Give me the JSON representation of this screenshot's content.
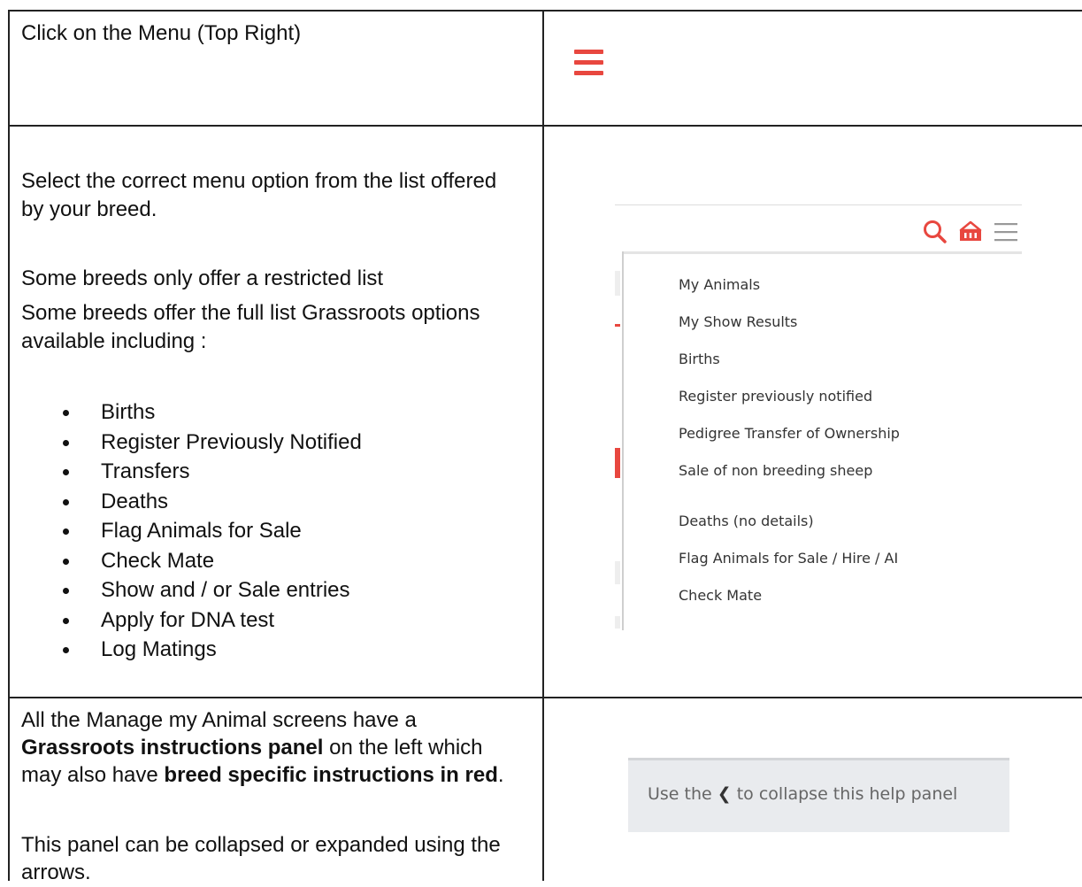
{
  "row1": {
    "instruction": "Click on the Menu (Top Right)",
    "menu_icon": "hamburger-menu-icon",
    "accent_color": "#e8473f"
  },
  "row2": {
    "instruction_line1": "Select the correct menu option from the list offered",
    "instruction_line2": "by your breed.",
    "restricted": "Some breeds only offer a restricted list",
    "full_line1": "Some breeds offer the full list Grassroots options",
    "full_line2": "available including :",
    "bullets": [
      "Births",
      "Register Previously Notified",
      "Transfers",
      "Deaths",
      "Flag Animals for Sale",
      "Check Mate",
      "Show and / or Sale entries",
      "Apply for DNA test",
      "Log Matings"
    ],
    "menu_screenshot": {
      "icons": [
        "search-icon",
        "basket-icon",
        "menu-icon"
      ],
      "items": [
        "My Animals",
        "My Show Results",
        "Births",
        "Register previously notified",
        "Pedigree Transfer of Ownership",
        "Sale of non breeding sheep",
        "Deaths (no details)",
        "Flag Animals for Sale / Hire / AI",
        "Check Mate"
      ]
    }
  },
  "row3": {
    "line1": "All the Manage my Animal screens have a",
    "line2_bold": "Grassroots instructions panel",
    "line2_rest": " on the left which",
    "line3_pre": "may also have ",
    "line3_bold": "breed specific instructions in red",
    "line3_post": ".",
    "line4": "This panel can be collapsed or expanded using the",
    "line5": "arrows.",
    "help_panel": {
      "text_pre": "Use the ",
      "chevron": "❮",
      "text_post": " to collapse this help panel"
    }
  }
}
